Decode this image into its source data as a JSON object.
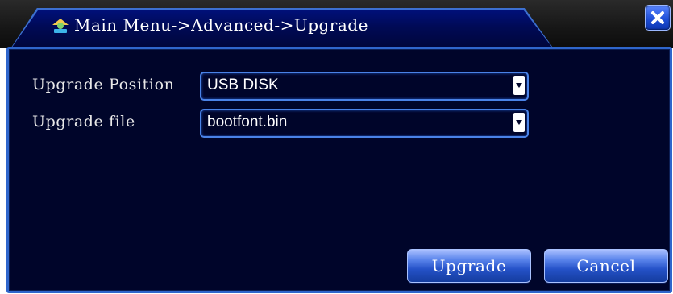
{
  "window": {
    "title": "Main Menu->Advanced->Upgrade",
    "title_icon": "home-user-icon",
    "close_icon": "close-x-icon"
  },
  "form": {
    "upgrade_position": {
      "label": "Upgrade Position",
      "value": "USB DISK"
    },
    "upgrade_file": {
      "label": "Upgrade file",
      "value": "bootfont.bin"
    }
  },
  "buttons": {
    "upgrade": "Upgrade",
    "cancel": "Cancel"
  },
  "colors": {
    "dialog_background": "#00052a",
    "border_accent": "#2f66cc",
    "text": "#ffffff"
  }
}
